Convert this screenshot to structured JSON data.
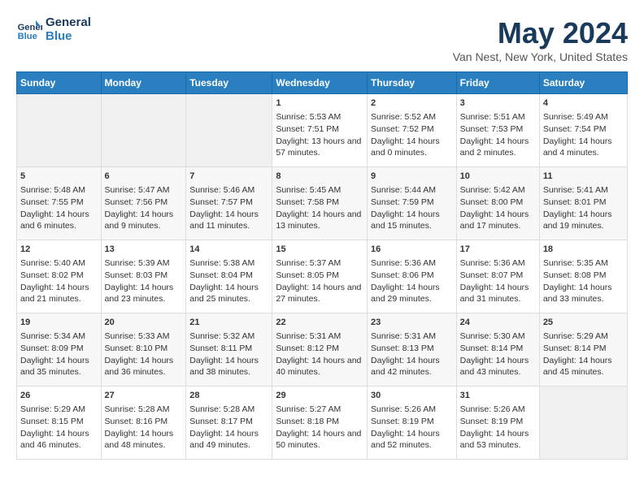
{
  "header": {
    "logo_line1": "General",
    "logo_line2": "Blue",
    "title": "May 2024",
    "subtitle": "Van Nest, New York, United States"
  },
  "days_of_week": [
    "Sunday",
    "Monday",
    "Tuesday",
    "Wednesday",
    "Thursday",
    "Friday",
    "Saturday"
  ],
  "weeks": [
    [
      {
        "day": "",
        "content": ""
      },
      {
        "day": "",
        "content": ""
      },
      {
        "day": "",
        "content": ""
      },
      {
        "day": "1",
        "content": "Sunrise: 5:53 AM\nSunset: 7:51 PM\nDaylight: 13 hours and 57 minutes."
      },
      {
        "day": "2",
        "content": "Sunrise: 5:52 AM\nSunset: 7:52 PM\nDaylight: 14 hours and 0 minutes."
      },
      {
        "day": "3",
        "content": "Sunrise: 5:51 AM\nSunset: 7:53 PM\nDaylight: 14 hours and 2 minutes."
      },
      {
        "day": "4",
        "content": "Sunrise: 5:49 AM\nSunset: 7:54 PM\nDaylight: 14 hours and 4 minutes."
      }
    ],
    [
      {
        "day": "5",
        "content": "Sunrise: 5:48 AM\nSunset: 7:55 PM\nDaylight: 14 hours and 6 minutes."
      },
      {
        "day": "6",
        "content": "Sunrise: 5:47 AM\nSunset: 7:56 PM\nDaylight: 14 hours and 9 minutes."
      },
      {
        "day": "7",
        "content": "Sunrise: 5:46 AM\nSunset: 7:57 PM\nDaylight: 14 hours and 11 minutes."
      },
      {
        "day": "8",
        "content": "Sunrise: 5:45 AM\nSunset: 7:58 PM\nDaylight: 14 hours and 13 minutes."
      },
      {
        "day": "9",
        "content": "Sunrise: 5:44 AM\nSunset: 7:59 PM\nDaylight: 14 hours and 15 minutes."
      },
      {
        "day": "10",
        "content": "Sunrise: 5:42 AM\nSunset: 8:00 PM\nDaylight: 14 hours and 17 minutes."
      },
      {
        "day": "11",
        "content": "Sunrise: 5:41 AM\nSunset: 8:01 PM\nDaylight: 14 hours and 19 minutes."
      }
    ],
    [
      {
        "day": "12",
        "content": "Sunrise: 5:40 AM\nSunset: 8:02 PM\nDaylight: 14 hours and 21 minutes."
      },
      {
        "day": "13",
        "content": "Sunrise: 5:39 AM\nSunset: 8:03 PM\nDaylight: 14 hours and 23 minutes."
      },
      {
        "day": "14",
        "content": "Sunrise: 5:38 AM\nSunset: 8:04 PM\nDaylight: 14 hours and 25 minutes."
      },
      {
        "day": "15",
        "content": "Sunrise: 5:37 AM\nSunset: 8:05 PM\nDaylight: 14 hours and 27 minutes."
      },
      {
        "day": "16",
        "content": "Sunrise: 5:36 AM\nSunset: 8:06 PM\nDaylight: 14 hours and 29 minutes."
      },
      {
        "day": "17",
        "content": "Sunrise: 5:36 AM\nSunset: 8:07 PM\nDaylight: 14 hours and 31 minutes."
      },
      {
        "day": "18",
        "content": "Sunrise: 5:35 AM\nSunset: 8:08 PM\nDaylight: 14 hours and 33 minutes."
      }
    ],
    [
      {
        "day": "19",
        "content": "Sunrise: 5:34 AM\nSunset: 8:09 PM\nDaylight: 14 hours and 35 minutes."
      },
      {
        "day": "20",
        "content": "Sunrise: 5:33 AM\nSunset: 8:10 PM\nDaylight: 14 hours and 36 minutes."
      },
      {
        "day": "21",
        "content": "Sunrise: 5:32 AM\nSunset: 8:11 PM\nDaylight: 14 hours and 38 minutes."
      },
      {
        "day": "22",
        "content": "Sunrise: 5:31 AM\nSunset: 8:12 PM\nDaylight: 14 hours and 40 minutes."
      },
      {
        "day": "23",
        "content": "Sunrise: 5:31 AM\nSunset: 8:13 PM\nDaylight: 14 hours and 42 minutes."
      },
      {
        "day": "24",
        "content": "Sunrise: 5:30 AM\nSunset: 8:14 PM\nDaylight: 14 hours and 43 minutes."
      },
      {
        "day": "25",
        "content": "Sunrise: 5:29 AM\nSunset: 8:14 PM\nDaylight: 14 hours and 45 minutes."
      }
    ],
    [
      {
        "day": "26",
        "content": "Sunrise: 5:29 AM\nSunset: 8:15 PM\nDaylight: 14 hours and 46 minutes."
      },
      {
        "day": "27",
        "content": "Sunrise: 5:28 AM\nSunset: 8:16 PM\nDaylight: 14 hours and 48 minutes."
      },
      {
        "day": "28",
        "content": "Sunrise: 5:28 AM\nSunset: 8:17 PM\nDaylight: 14 hours and 49 minutes."
      },
      {
        "day": "29",
        "content": "Sunrise: 5:27 AM\nSunset: 8:18 PM\nDaylight: 14 hours and 50 minutes."
      },
      {
        "day": "30",
        "content": "Sunrise: 5:26 AM\nSunset: 8:19 PM\nDaylight: 14 hours and 52 minutes."
      },
      {
        "day": "31",
        "content": "Sunrise: 5:26 AM\nSunset: 8:19 PM\nDaylight: 14 hours and 53 minutes."
      },
      {
        "day": "",
        "content": ""
      }
    ]
  ]
}
